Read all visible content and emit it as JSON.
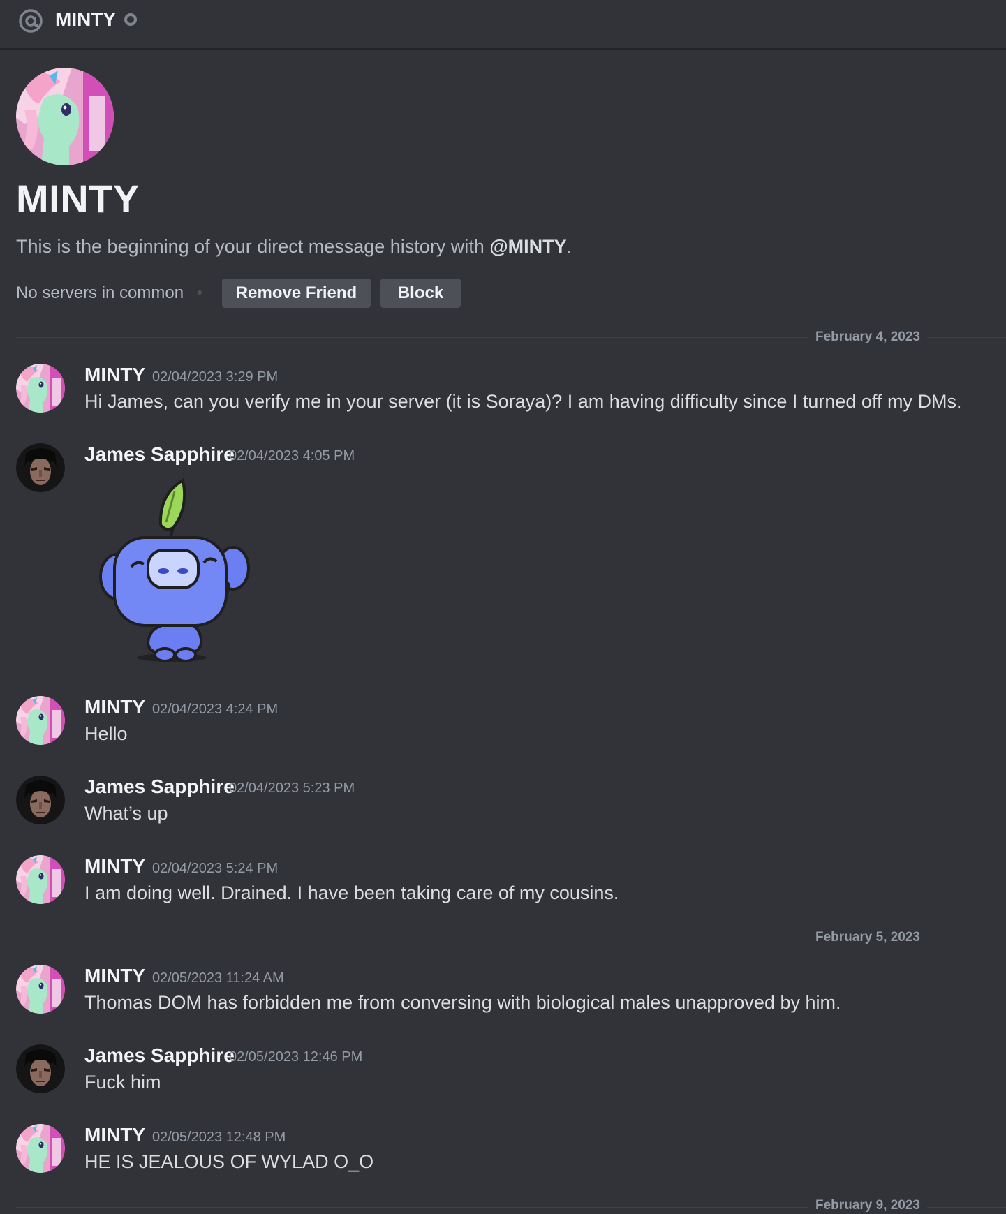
{
  "header": {
    "channel_icon": "at-icon",
    "title": "MINTY",
    "status": "offline-status-icon"
  },
  "profile": {
    "name": "MINTY",
    "intro_prefix": "This is the beginning of your direct message history with ",
    "intro_handle": "@MINTY",
    "intro_suffix": ".",
    "servers_common": "No servers in common",
    "remove_friend_label": "Remove Friend",
    "block_label": "Block"
  },
  "dividers": [
    {
      "label": "February 4, 2023"
    },
    {
      "label": "February 5, 2023"
    },
    {
      "label": "February 9, 2023"
    }
  ],
  "messages": [
    {
      "author": "MINTY",
      "timestamp": "02/04/2023 3:29 PM",
      "text": "Hi James, can you verify me in your server (it is Soraya)? I am having difficulty since I turned off my DMs."
    },
    {
      "author": "James Sapphire",
      "timestamp": "02/04/2023 4:05 PM",
      "text": "",
      "sticker": "wumpus-wave-sticker"
    },
    {
      "author": "MINTY",
      "timestamp": "02/04/2023 4:24 PM",
      "text": "Hello"
    },
    {
      "author": "James Sapphire",
      "timestamp": "02/04/2023 5:23 PM",
      "text": "What’s up"
    },
    {
      "author": "MINTY",
      "timestamp": "02/04/2023 5:24 PM",
      "text": "I am doing well. Drained. I have been taking care of my cousins."
    },
    {
      "author": "MINTY",
      "timestamp": "02/05/2023 11:24 AM",
      "text": "Thomas DOM has forbidden me from conversing with biological males unapproved by him."
    },
    {
      "author": "James Sapphire",
      "timestamp": "02/05/2023 12:46 PM",
      "text": "Fuck him"
    },
    {
      "author": "MINTY",
      "timestamp": "02/05/2023 12:48 PM",
      "text": "HE IS JEALOUS OF WYLAD O_O"
    }
  ],
  "colors": {
    "background": "#313338",
    "button": "#4e5058",
    "muted_text": "#949ba4"
  }
}
